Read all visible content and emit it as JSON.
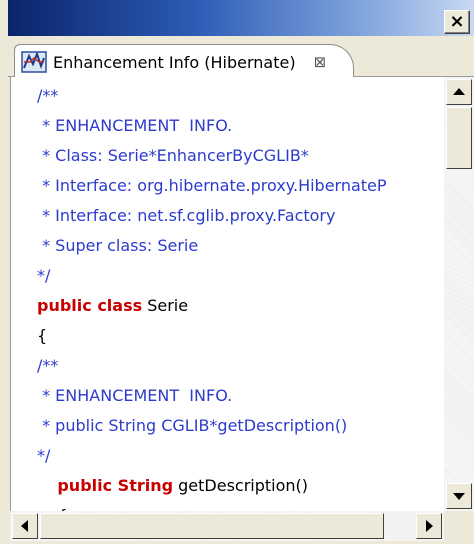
{
  "window": {
    "close_glyph": "×"
  },
  "tab": {
    "icon": "hibernate-enhancement-icon",
    "label": "Enhancement Info (Hibernate)",
    "close_glyph": "⊠"
  },
  "code_lines": [
    {
      "text": "/**",
      "style": "comment",
      "indent": ""
    },
    {
      "text": " * ENHANCEMENT  INFO.",
      "style": "comment",
      "indent": ""
    },
    {
      "text": " * Class: Serie*EnhancerByCGLIB*",
      "style": "comment",
      "indent": ""
    },
    {
      "text": " * Interface: org.hibernate.proxy.HibernateP",
      "style": "comment",
      "indent": ""
    },
    {
      "text": " * Interface: net.sf.cglib.proxy.Factory",
      "style": "comment",
      "indent": ""
    },
    {
      "text": " * Super class: Serie",
      "style": "comment",
      "indent": ""
    },
    {
      "text": "*/",
      "style": "comment",
      "indent": ""
    },
    {
      "keyword": "public class",
      "text": " Serie",
      "style": "mixed",
      "indent": ""
    },
    {
      "text": "{",
      "style": "plain",
      "indent": ""
    },
    {
      "text": "/**",
      "style": "comment",
      "indent": ""
    },
    {
      "text": " * ENHANCEMENT  INFO.",
      "style": "comment",
      "indent": ""
    },
    {
      "text": " * public String CGLIB*getDescription()",
      "style": "comment",
      "indent": ""
    },
    {
      "text": "*/",
      "style": "comment",
      "indent": ""
    },
    {
      "keyword": "public String",
      "text": " getDescription()",
      "style": "mixed",
      "indent": "    "
    },
    {
      "text": "{",
      "style": "plain",
      "indent": "    "
    }
  ],
  "colors": {
    "comment": "#2b3ccc",
    "keyword": "#c80000",
    "title_bar": "#0a246a"
  }
}
